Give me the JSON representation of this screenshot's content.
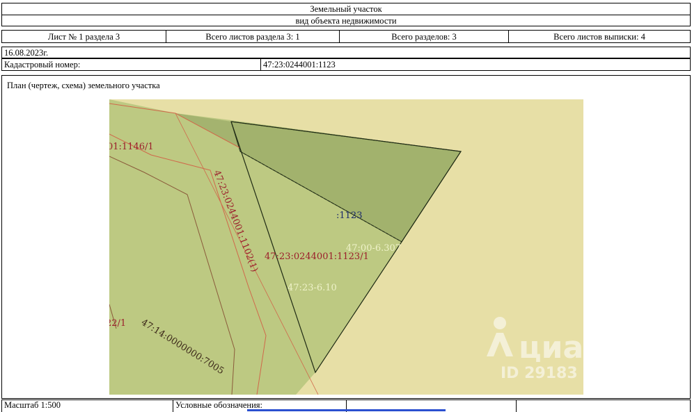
{
  "header": {
    "title": "Земельный участок",
    "subtitle": "вид объекта недвижимости"
  },
  "sheet_info": {
    "sheet": "Лист № 1 раздела 3",
    "total_sheets_section": "Всего листов раздела 3: 1",
    "total_sections": "Всего разделов: 3",
    "total_sheets_extract": "Всего листов выписки: 4"
  },
  "date": "16.08.2023г.",
  "cadastral": {
    "label": "Кадастровый номер:",
    "value": "47:23:0244001:1123"
  },
  "plan_title": "План (чертеж, схема) земельного участка",
  "map_labels": {
    "parcel_1146": "01:1146/1",
    "parcel_1102": "47:23:0244001:1102(1)",
    "short_1123": ":1123",
    "zone_6307": "47:00-6.307",
    "parcel_1123": "47:23:0244001:1123/1",
    "zone_610": "47:23-6.10",
    "parcel_22": "22/1",
    "parcel_7005": "47:14:0000000:7005"
  },
  "watermark": {
    "brand": "циан",
    "id": "ID 29183"
  },
  "footer": {
    "scale": "Масштаб 1:500",
    "legend": "Условные обозначения:"
  },
  "colors": {
    "background_zone": "#e7dfa6",
    "green_area": "#bdc982",
    "parcel_fill": "#a2b26d",
    "boundary_line": "#d0684a",
    "label_text": "#9b1e2b"
  }
}
